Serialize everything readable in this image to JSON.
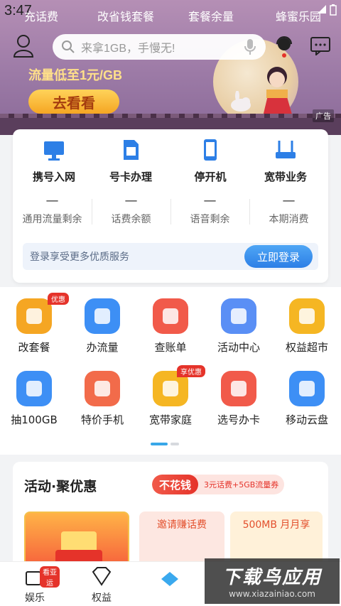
{
  "status": {
    "time": "3:47"
  },
  "top_tabs": [
    "充话费",
    "改省钱套餐",
    "套餐余量",
    "蜂蜜乐园"
  ],
  "search": {
    "placeholder": "来拿1GB，手慢无!"
  },
  "banner": {
    "line": "流量低至1元/GB",
    "button": "去看看",
    "ad": "广告"
  },
  "services": [
    {
      "label": "携号入网",
      "icon": "computer-icon"
    },
    {
      "label": "号卡办理",
      "icon": "sim-card-icon"
    },
    {
      "label": "停开机",
      "icon": "phone-icon"
    },
    {
      "label": "宽带业务",
      "icon": "router-icon"
    }
  ],
  "balances": [
    {
      "value": "—",
      "label": "通用流量剩余"
    },
    {
      "value": "—",
      "label": "话费余额"
    },
    {
      "value": "—",
      "label": "语音剩余"
    },
    {
      "value": "—",
      "label": "本期消费"
    }
  ],
  "login": {
    "text": "登录享受更多优质服务",
    "button": "立即登录"
  },
  "grid": [
    {
      "label": "改套餐",
      "icon": "layers-icon",
      "color": "#f5a623",
      "badge": "优惠"
    },
    {
      "label": "办流量",
      "icon": "drop-chart-icon",
      "color": "#3d8ff5"
    },
    {
      "label": "查账单",
      "icon": "bill-search-icon",
      "color": "#f15a4a"
    },
    {
      "label": "活动中心",
      "icon": "gift-icon",
      "color": "#5a8ff5"
    },
    {
      "label": "权益超市",
      "icon": "v-badge-icon",
      "color": "#f5b623"
    },
    {
      "label": "抽100GB",
      "icon": "lucky-bag-icon",
      "color": "#3d8ff5"
    },
    {
      "label": "特价手机",
      "icon": "phone-fire-icon",
      "color": "#f26b4a"
    },
    {
      "label": "宽带家庭",
      "icon": "wifi-router-icon",
      "color": "#f5b623",
      "badge": "享优惠"
    },
    {
      "label": "选号办卡",
      "icon": "number-card-icon",
      "color": "#f15a4a"
    },
    {
      "label": "移动云盘",
      "icon": "cloud-upload-icon",
      "color": "#3d8ff5"
    }
  ],
  "activity": {
    "title": "活动·聚优惠",
    "tag_main": "不花钱",
    "tag_sub": "3元话费+5GB流量券",
    "cards": [
      "",
      "邀请赚话费",
      "500MB 月月享"
    ]
  },
  "tabbar": [
    {
      "label": "娱乐",
      "icon": "cup-icon",
      "badge": "看亚运"
    },
    {
      "label": "权益",
      "icon": "diamond-icon"
    },
    {
      "label": "",
      "icon": "home-icon"
    }
  ],
  "watermark": {
    "main": "下载鸟应用",
    "sub": "www.xiazainiao.com"
  }
}
